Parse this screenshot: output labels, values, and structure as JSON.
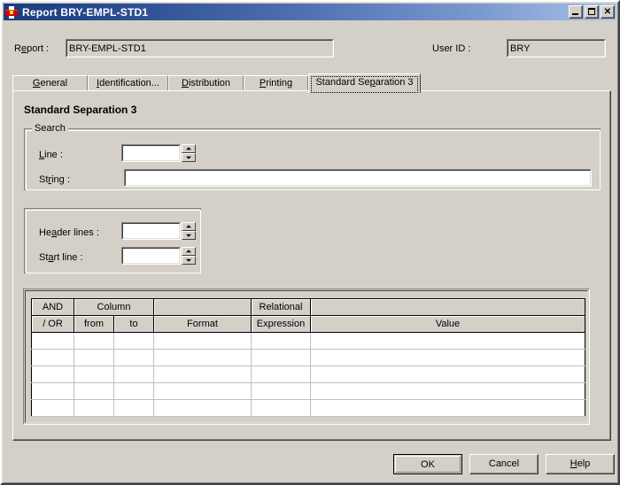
{
  "window": {
    "title": "Report BRY-EMPL-STD1",
    "icon": "report-window-icon",
    "controls": {
      "minimize": "minimize-icon",
      "maximize": "maximize-icon",
      "close": "close-icon"
    }
  },
  "header": {
    "report_label_pre": "R",
    "report_label_key": "e",
    "report_label_post": "port :",
    "report_label": "Report :",
    "report_value": "BRY-EMPL-STD1",
    "userid_label": "User ID :",
    "userid_value": "BRY"
  },
  "tabs": [
    {
      "label": "General",
      "accel": "G",
      "selected": false
    },
    {
      "label": "Identification...",
      "accel": "I",
      "selected": false
    },
    {
      "label": "Distribution",
      "accel": "D",
      "selected": false
    },
    {
      "label": "Printing",
      "accel": "P",
      "selected": false
    },
    {
      "label": "Standard Separation 3",
      "accel": "p",
      "selected": true
    }
  ],
  "panel": {
    "title": "Standard Separation 3",
    "search_group": {
      "legend": "Search",
      "line_label": "Line :",
      "line_value": "",
      "string_label": "String :",
      "string_value": ""
    },
    "lines_group": {
      "header_lines_label": "Header lines :",
      "header_lines_value": "",
      "start_line_label": "Start line :",
      "start_line_value": ""
    },
    "grid": {
      "header_row_1": [
        "AND",
        "Column",
        "",
        "Relational",
        ""
      ],
      "header_row_2": [
        "/ OR",
        "from",
        "to",
        "Format",
        "Expression",
        "Value"
      ],
      "columns": [
        "AND / OR",
        "Column from",
        "Column to",
        "Format",
        "Relational Expression",
        "Value"
      ],
      "rows": [
        [
          "",
          "",
          "",
          "",
          "",
          ""
        ],
        [
          "",
          "",
          "",
          "",
          "",
          ""
        ],
        [
          "",
          "",
          "",
          "",
          "",
          ""
        ],
        [
          "",
          "",
          "",
          "",
          "",
          ""
        ],
        [
          "",
          "",
          "",
          "",
          "",
          ""
        ]
      ]
    }
  },
  "footer": {
    "ok_label": "OK",
    "cancel_label": "Cancel",
    "help_label": "Help",
    "help_accel": "H"
  },
  "colors": {
    "face": "#d4d0c8",
    "titlebar_start": "#1d3c7e",
    "titlebar_end": "#a8c2e8",
    "field_bg": "#ffffff",
    "text": "#000000"
  }
}
